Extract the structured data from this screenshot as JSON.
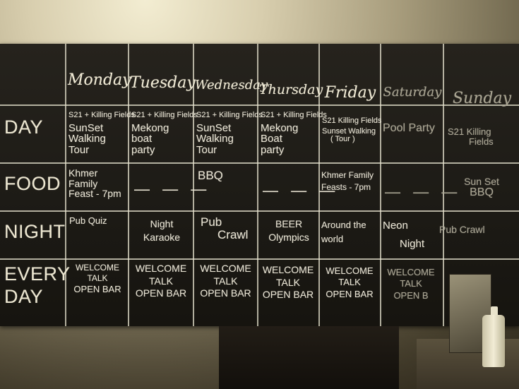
{
  "days": [
    "Monday",
    "Tuesday",
    "Wednesday",
    "Thursday",
    "Friday",
    "Saturday",
    "Sunday"
  ],
  "rows": [
    "DAY",
    "FOOD",
    "NIGHT",
    "EVERY DAY"
  ],
  "day_row": [
    {
      "line1": "S21 + Killing Fields",
      "line2": "SunSet",
      "line3": "Walking",
      "line4": "Tour"
    },
    {
      "line1": "S21 + Killing Fields",
      "line2": "Mekong",
      "line3": "boat",
      "line4": "party"
    },
    {
      "line1": "S21 + Killing Fields",
      "line2": "SunSet",
      "line3": "Walking",
      "line4": "Tour"
    },
    {
      "line1": "S21 + Killing Fields",
      "line2": "Mekong",
      "line3": "Boat",
      "line4": "party"
    },
    {
      "line1": "S21 Killing Fields",
      "line2": "Sunset Walking",
      "line3": "( Tour )",
      "line4": ""
    },
    {
      "line1": "Pool Party",
      "line2": "",
      "line3": "",
      "line4": ""
    },
    {
      "line1": "S21 Killing",
      "line2": "Fields",
      "line3": "",
      "line4": ""
    }
  ],
  "food_row": [
    {
      "line1": "Khmer",
      "line2": "Family",
      "line3": "Feast - 7pm"
    },
    {
      "line1": "— — —",
      "line2": "",
      "line3": ""
    },
    {
      "line1": "BBQ",
      "line2": "",
      "line3": ""
    },
    {
      "line1": "— — —",
      "line2": "",
      "line3": ""
    },
    {
      "line1": "Khmer Family",
      "line2": "Feasts - 7pm",
      "line3": ""
    },
    {
      "line1": "— — —",
      "line2": "",
      "line3": ""
    },
    {
      "line1": "Sun Set",
      "line2": "BBQ",
      "line3": ""
    }
  ],
  "night_row": [
    {
      "line1": "Pub Quiz",
      "line2": ""
    },
    {
      "line1": "Night",
      "line2": "Karaoke"
    },
    {
      "line1": "Pub",
      "line2": "Crawl"
    },
    {
      "line1": "BEER",
      "line2": "Olympics"
    },
    {
      "line1": "Around the",
      "line2": "world"
    },
    {
      "line1": "Neon",
      "line2": "Night"
    },
    {
      "line1": "Pub Crawl",
      "line2": ""
    }
  ],
  "everyday_row": [
    {
      "line1": "WELCOME",
      "line2": "TALK",
      "line3": "OPEN BAR"
    },
    {
      "line1": "WELCOME",
      "line2": "TALK",
      "line3": "OPEN BAR"
    },
    {
      "line1": "WELCOME",
      "line2": "TALK",
      "line3": "OPEN BAR"
    },
    {
      "line1": "WELCOME",
      "line2": "TALK",
      "line3": "OPEN BAR"
    },
    {
      "line1": "WELCOME",
      "line2": "TALK",
      "line3": "OPEN BAR"
    },
    {
      "line1": "WELCOME",
      "line2": "TALK",
      "line3": "OPEN B"
    },
    {
      "line1": "",
      "line2": "",
      "line3": ""
    }
  ],
  "colors": {
    "chalk": "#e8e3d2",
    "board": "#1f1d18",
    "wall": "#d8ceae"
  }
}
